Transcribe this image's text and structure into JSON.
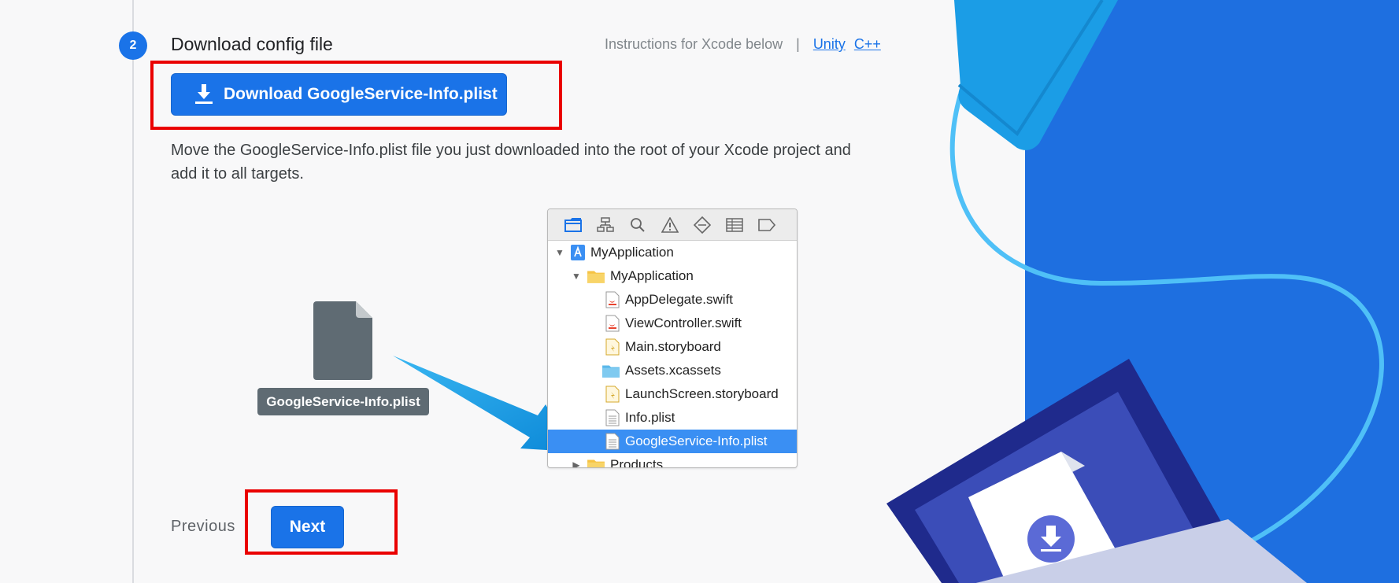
{
  "step": {
    "number": "2",
    "title": "Download config file"
  },
  "instructions": {
    "text": "Instructions for Xcode below",
    "separator": "|",
    "links": [
      "Unity",
      "C++"
    ]
  },
  "download_button": {
    "label": "Download GoogleService-Info.plist",
    "icon": "download-icon"
  },
  "description": "Move the GoogleService-Info.plist file you just downloaded into the root of your Xcode project and add it to all targets.",
  "file_label": "GoogleService-Info.plist",
  "xcode_tree": [
    {
      "label": "MyApplication",
      "icon": "xcode-project-icon",
      "expanded": true
    },
    {
      "label": "MyApplication",
      "icon": "folder-icon",
      "expanded": true
    },
    {
      "label": "AppDelegate.swift",
      "icon": "swift-file-icon"
    },
    {
      "label": "ViewController.swift",
      "icon": "swift-file-icon"
    },
    {
      "label": "Main.storyboard",
      "icon": "storyboard-file-icon"
    },
    {
      "label": "Assets.xcassets",
      "icon": "assets-folder-icon"
    },
    {
      "label": "LaunchScreen.storyboard",
      "icon": "storyboard-file-icon"
    },
    {
      "label": "Info.plist",
      "icon": "plist-file-icon"
    },
    {
      "label": "GoogleService-Info.plist",
      "icon": "plist-file-icon",
      "selected": true
    },
    {
      "label": "Products",
      "icon": "folder-icon",
      "expanded": false
    }
  ],
  "nav": {
    "previous_label": "Previous",
    "next_label": "Next"
  },
  "colors": {
    "primary": "#1a73e8",
    "highlight": "#ea0000",
    "illustration_blue": "#1e6fe0"
  }
}
